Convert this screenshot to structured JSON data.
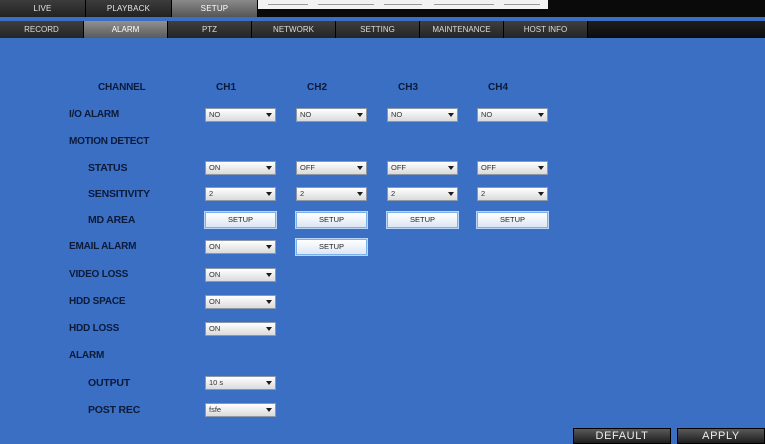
{
  "menu": {
    "top_tabs": [
      "LIVE",
      "PLAYBACK",
      "SETUP"
    ],
    "sub_tabs": [
      "RECORD",
      "ALARM",
      "PTZ",
      "NETWORK",
      "SETTING",
      "MAINTENANCE",
      "HOST INFO"
    ]
  },
  "alarm": {
    "channel_label": "CHANNEL",
    "channels": [
      "CH1",
      "CH2",
      "CH3",
      "CH4"
    ],
    "io_alarm": {
      "label": "I/O ALARM",
      "values": [
        "NO",
        "NO",
        "NO",
        "NO"
      ]
    },
    "motion_detect": {
      "label": "MOTION DETECT",
      "status": {
        "label": "STATUS",
        "values": [
          "ON",
          "OFF",
          "OFF",
          "OFF"
        ]
      },
      "sensitivity": {
        "label": "SENSITIVITY",
        "values": [
          "2",
          "2",
          "2",
          "2"
        ]
      },
      "md_area": {
        "label": "MD AREA",
        "button": "SETUP"
      }
    },
    "email_alarm": {
      "label": "EMAIL ALARM",
      "value": "ON",
      "button": "SETUP"
    },
    "video_loss": {
      "label": "VIDEO LOSS",
      "value": "ON"
    },
    "hdd_space": {
      "label": "HDD SPACE",
      "value": "ON"
    },
    "hdd_loss": {
      "label": "HDD LOSS",
      "value": "ON"
    },
    "alarm_section": {
      "label": "ALARM",
      "output": {
        "label": "OUTPUT",
        "value": "10 s"
      },
      "post_rec": {
        "label": "POST REC",
        "value": "fsfe"
      }
    }
  },
  "actions": {
    "default": "DEFAULT",
    "apply": "APPLY"
  }
}
